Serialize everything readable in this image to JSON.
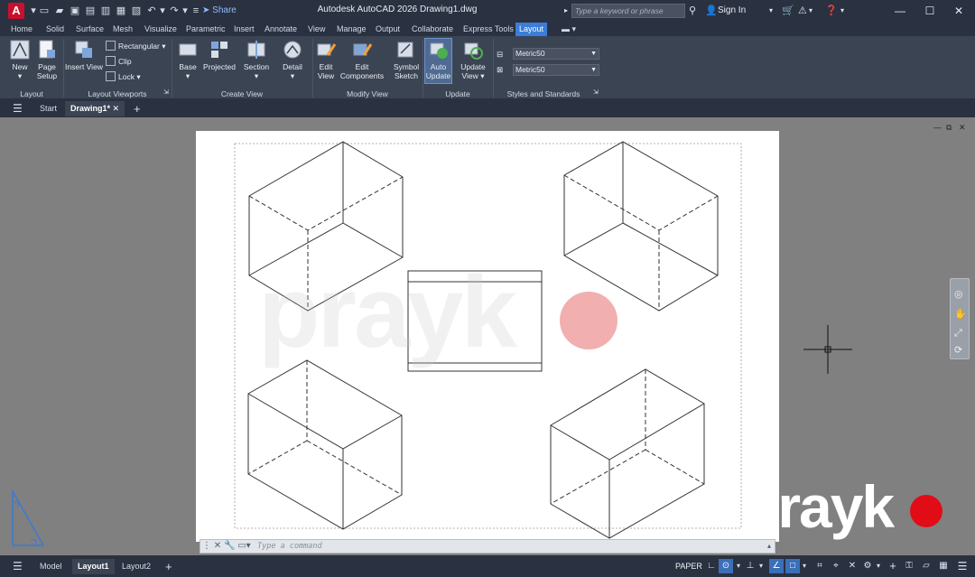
{
  "titlebar": {
    "app_logo": "A",
    "share": "Share",
    "title": "Autodesk AutoCAD 2026    Drawing1.dwg",
    "search_placeholder": "Type a keyword or phrase",
    "sign_in": "Sign In",
    "icons": [
      "new-icon",
      "open-icon",
      "save-icon",
      "saveas-icon",
      "web-mobile-icon",
      "plot-icon",
      "undo-icon",
      "redo-icon"
    ]
  },
  "ribbon_tabs": [
    "Home",
    "Solid",
    "Surface",
    "Mesh",
    "Visualize",
    "Parametric",
    "Insert",
    "Annotate",
    "View",
    "Manage",
    "Output",
    "Collaborate",
    "Express Tools",
    "Layout"
  ],
  "active_tab": "Layout",
  "ribbon": {
    "layout_panel": {
      "label": "Layout",
      "new": "New",
      "page_setup_1": "Page",
      "page_setup_2": "Setup"
    },
    "viewports_panel": {
      "label": "Layout Viewports",
      "insert_view": "Insert View",
      "rectangular": "Rectangular",
      "clip": "Clip",
      "lock": "Lock"
    },
    "create_view_panel": {
      "label": "Create View",
      "base": "Base",
      "projected": "Projected",
      "section": "Section",
      "detail": "Detail"
    },
    "modify_view_panel": {
      "label": "Modify View",
      "edit_view_1": "Edit",
      "edit_view_2": "View",
      "edit_components_1": "Edit",
      "edit_components_2": "Components",
      "symbol_sketch_1": "Symbol",
      "symbol_sketch_2": "Sketch"
    },
    "update_panel": {
      "label": "Update",
      "auto_update_1": "Auto",
      "auto_update_2": "Update",
      "update_view_1": "Update",
      "update_view_2": "View"
    },
    "styles_panel": {
      "label": "Styles and Standards",
      "style1": "Metric50",
      "style2": "Metric50"
    }
  },
  "doc_tabs": {
    "start": "Start",
    "drawing": "Drawing1*"
  },
  "command_line": {
    "placeholder": "Type a command"
  },
  "watermark": {
    "text": "prayk"
  },
  "layout_tabs": {
    "model": "Model",
    "layout1": "Layout1",
    "layout2": "Layout2"
  },
  "status": {
    "paper": "PAPER"
  },
  "colors": {
    "accent": "#3b7dd8",
    "logo_red": "#e10c16",
    "chrome_dark": "#2a3140",
    "ribbon_bg": "#3b4453"
  }
}
